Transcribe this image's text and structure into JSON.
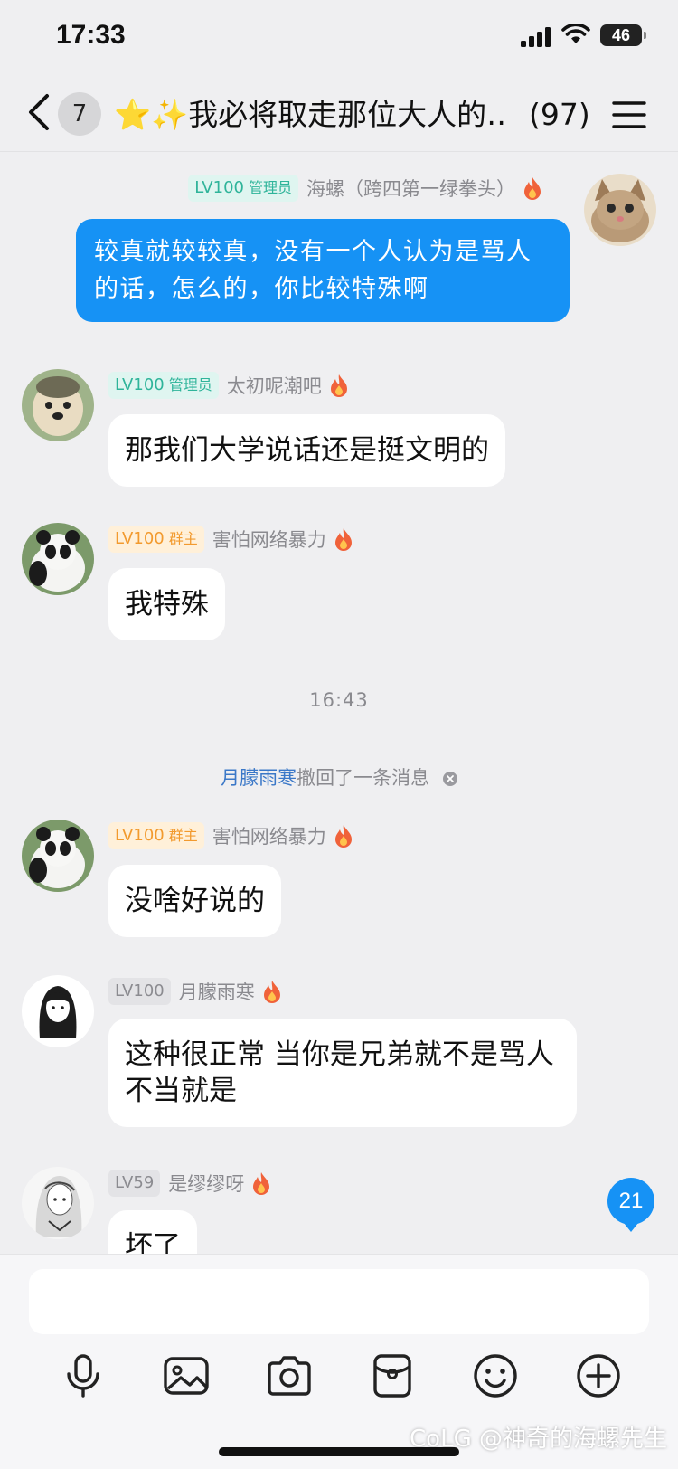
{
  "status_bar": {
    "time": "17:33",
    "battery": "46"
  },
  "nav": {
    "unread_count": "7",
    "title": "⭐✨我必将取走那位大人的…",
    "member_count": "(97)"
  },
  "messages": [
    {
      "type": "self",
      "level": "LV100",
      "role": "管理员",
      "name": "海螺（跨四第一绿拳头）",
      "text": "较真就较较真，没有一个人认为是骂人的话，怎么的，你比较特殊啊"
    },
    {
      "type": "other",
      "level": "LV100",
      "role": "管理员",
      "name": "太初呢潮吧",
      "text": "那我们大学说话还是挺文明的"
    },
    {
      "type": "other",
      "level": "LV100",
      "role": "群主",
      "name": "害怕网络暴力",
      "text": "我特殊"
    },
    {
      "type": "time",
      "text": "16:43"
    },
    {
      "type": "recall",
      "name": "月朦雨寒",
      "text": "撤回了一条消息"
    },
    {
      "type": "other",
      "level": "LV100",
      "role": "群主",
      "name": "害怕网络暴力",
      "text": "没啥好说的"
    },
    {
      "type": "other",
      "level": "LV100",
      "role": "",
      "name": "月朦雨寒",
      "text": "这种很正常 当你是兄弟就不是骂人 不当就是"
    },
    {
      "type": "other",
      "level": "LV59",
      "role": "",
      "name": "是缪缪呀",
      "text": "坏了"
    }
  ],
  "jump_badge": "21",
  "input": {
    "value": ""
  },
  "toolbar": [
    "mic-icon",
    "image-icon",
    "camera-icon",
    "red-packet-icon",
    "emoji-icon",
    "plus-icon"
  ],
  "watermark": "CoLG @神奇的海螺先生",
  "colors": {
    "accent": "#1692f5",
    "admin_badge": "#2fb49a",
    "owner_badge": "#f29a2e",
    "background": "#efeff1"
  }
}
